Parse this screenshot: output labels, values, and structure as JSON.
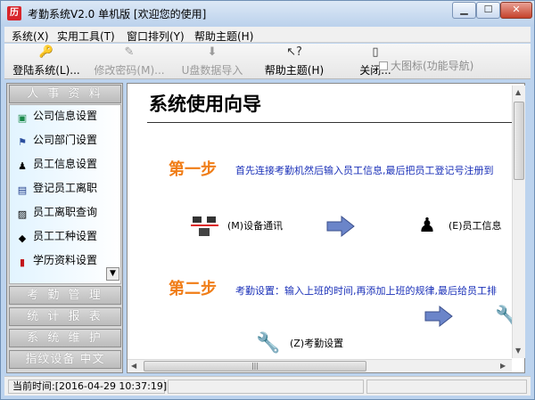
{
  "window": {
    "title": "考勤系统V2.0 单机版 [欢迎您的使用]",
    "app_icon": "cal-icon"
  },
  "menu": [
    "系统(X)",
    "实用工具(T)",
    "窗口排列(Y)",
    "帮助主题(H)"
  ],
  "toolbar": {
    "buttons": [
      {
        "label": "登陆系统(L)...",
        "icon": "login-icon",
        "enabled": true
      },
      {
        "label": "修改密码(M)...",
        "icon": "edit-password-icon",
        "enabled": false
      },
      {
        "label": "U盘数据导入",
        "icon": "import-arrow-icon",
        "enabled": false
      },
      {
        "label": "帮助主题(H)",
        "icon": "help-cursor-icon",
        "enabled": true
      },
      {
        "label": "关闭...",
        "icon": "close-doc-icon",
        "enabled": true
      }
    ],
    "large_icon_checkbox": "大图标(功能导航)"
  },
  "sidebar": {
    "sections": [
      "人 事 资 料",
      "考 勤 管 理",
      "统 计 报 表",
      "系 统 维 护",
      "指纹设备 中文"
    ],
    "items": [
      "公司信息设置",
      "公司部门设置",
      "员工信息设置",
      "登记员工离职",
      "员工离职查询",
      "员工工种设置",
      "学历资料设置"
    ]
  },
  "main": {
    "title": "系统使用向导",
    "steps": [
      {
        "head": "第一步",
        "text": "首先连接考勤机然后输入员工信息,最后把员工登记号注册到"
      },
      {
        "head": "第二步",
        "text": "考勤设置：输入上班的时间,再添加上班的规律,最后给员工排"
      }
    ],
    "actions": [
      {
        "label": "(M)设备通讯",
        "icon": "device-comm-icon"
      },
      {
        "label": "(E)员工信息",
        "icon": "employee-icon"
      },
      {
        "label": "(Z)考勤设置",
        "icon": "wrench-icon"
      }
    ]
  },
  "status": {
    "time_label": "当前时间:",
    "time_value": "[2016-04-29 10:37:19]"
  },
  "colors": {
    "step_heading": "#f07d17",
    "step_text": "#1a30b8",
    "sidebar_head": "#bcbcbc",
    "arrow": "#6b85c9"
  }
}
